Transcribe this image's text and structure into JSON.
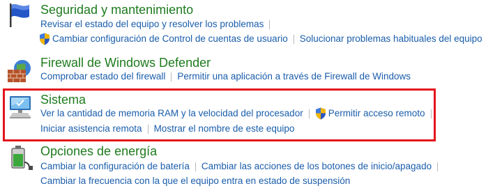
{
  "sections": [
    {
      "title": "Seguridad y mantenimiento",
      "links": [
        "Revisar el estado del equipo y resolver los problemas",
        "Cambiar configuración de Control de cuentas de usuario",
        "Solucionar problemas habituales del equipo"
      ]
    },
    {
      "title": "Firewall de Windows Defender",
      "links": [
        "Comprobar estado del firewall",
        "Permitir una aplicación a través de Firewall de Windows"
      ]
    },
    {
      "title": "Sistema",
      "links": [
        "Ver la cantidad de memoria RAM y la velocidad del procesador",
        "Permitir acceso remoto",
        "Iniciar asistencia remota",
        "Mostrar el nombre de este equipo"
      ]
    },
    {
      "title": "Opciones de energía",
      "links": [
        "Cambiar la configuración de batería",
        "Cambiar las acciones de los botones de inicio/apagado",
        "Cambiar la frecuencia con la que el equipo entra en estado de suspensión"
      ]
    }
  ],
  "colors": {
    "title": "#1e7b1e",
    "link": "#1a5dab",
    "separator": "#b8b8b8",
    "highlight": "#e3141c"
  },
  "icons": {
    "security": "flag-icon",
    "firewall": "firewall-icon",
    "system": "computer-icon",
    "power": "battery-icon",
    "uac": "uac-shield-icon"
  }
}
